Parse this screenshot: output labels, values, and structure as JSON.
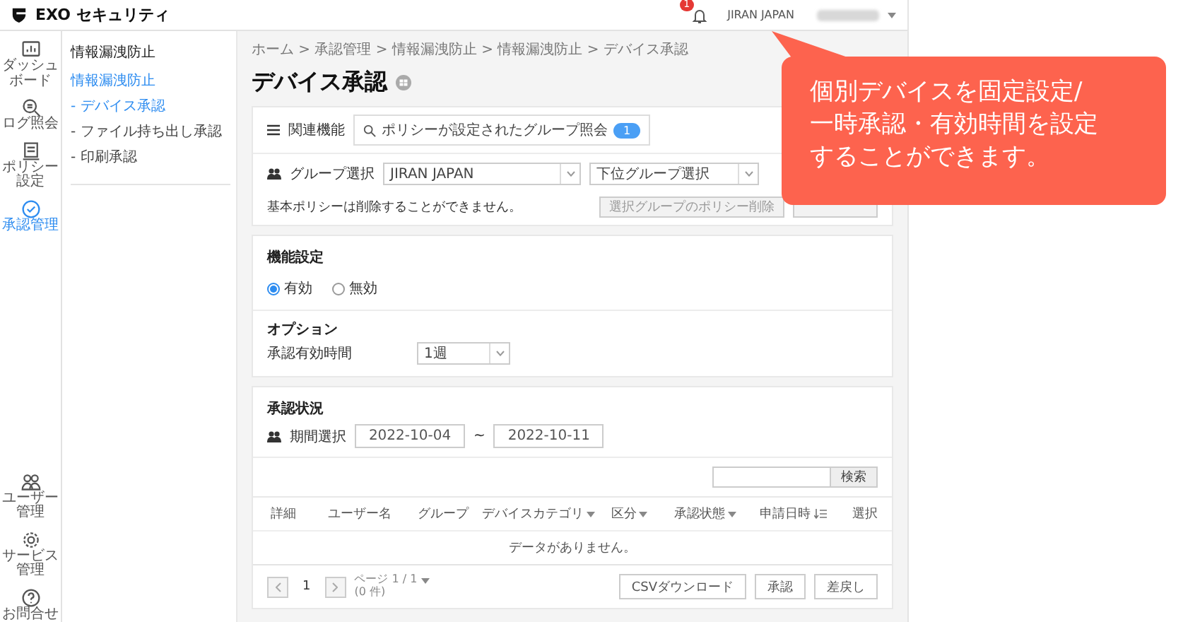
{
  "header": {
    "logo_text": "EXO セキュリティ",
    "notification_count": "1",
    "company": "JIRAN JAPAN"
  },
  "rail": {
    "top_items": [
      {
        "label": "ダッシュボード",
        "selected": false
      },
      {
        "label": "ログ照会",
        "selected": false
      },
      {
        "label": "ポリシー設定",
        "selected": false
      },
      {
        "label": "承認管理",
        "selected": true
      }
    ],
    "bottom_items": [
      {
        "label": "ユーザー管理",
        "selected": false
      },
      {
        "label": "サービス管理",
        "selected": false
      },
      {
        "label": "お問合せ",
        "selected": false
      }
    ]
  },
  "sidebar": {
    "title": "情報漏洩防止",
    "section": "情報漏洩防止",
    "items": [
      {
        "label": "- デバイス承認",
        "selected": true
      },
      {
        "label": "- ファイル持ち出し承認",
        "selected": false
      },
      {
        "label": "- 印刷承認",
        "selected": false
      }
    ]
  },
  "breadcrumb": "ホーム > 承認管理 > 情報漏洩防止 > 情報漏洩防止 > デバイス承認",
  "page_title": "デバイス承認",
  "related": {
    "label": "関連機能",
    "search_text": "ポリシーが設定されたグループ照会",
    "badge": "1"
  },
  "group_select": {
    "label": "グループ選択",
    "group": "JIRAN JAPAN",
    "subgroup_placeholder": "下位グループ選択"
  },
  "policy_note": "基本ポリシーは削除することができません。",
  "policy_buttons": [
    {
      "label": "選択グループのポリシー削除"
    }
  ],
  "feature": {
    "title": "機能設定",
    "options": [
      {
        "label": "有効",
        "selected": true
      },
      {
        "label": "無効",
        "selected": false
      }
    ]
  },
  "option": {
    "title": "オプション",
    "label": "承認有効時間",
    "value": "1週"
  },
  "status": {
    "title": "承認状況",
    "period_label": "期間選択",
    "from": "2022-10-04",
    "separator": "~",
    "to": "2022-10-11",
    "search_button": "検索"
  },
  "table": {
    "columns": [
      {
        "label": "詳細",
        "kind": "plain"
      },
      {
        "label": "ユーザー名",
        "kind": "plain"
      },
      {
        "label": "グループ",
        "kind": "plain"
      },
      {
        "label": "デバイスカテゴリ",
        "kind": "filter"
      },
      {
        "label": "区分",
        "kind": "filter"
      },
      {
        "label": "承認状態",
        "kind": "filter"
      },
      {
        "label": "申請日時",
        "kind": "sortable"
      },
      {
        "label": "選択",
        "kind": "plain"
      }
    ],
    "empty_message": "データがありません。"
  },
  "pagination": {
    "page": "1",
    "page_info": "ページ 1 / 1",
    "count": "(0 件)"
  },
  "actions": [
    {
      "label": "CSVダウンロード"
    },
    {
      "label": "承認"
    },
    {
      "label": "差戻し"
    }
  ],
  "callout": {
    "lines": [
      "個別デバイスを固定設定/",
      "一時承認・有効時間を設定",
      "することができます。"
    ]
  }
}
